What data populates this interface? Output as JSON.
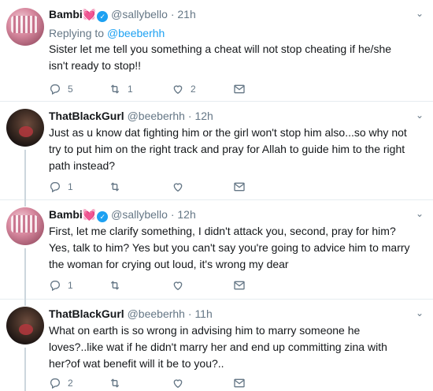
{
  "tweets": [
    {
      "name": "Bambi",
      "emoji": "💓",
      "handle": "@sallybello",
      "time": "21h",
      "reply_prefix": "Replying to",
      "reply_handle": "@beeberhh",
      "text": "Sister let me tell you something a cheat will not stop cheating if he/she isn't ready to stop!!",
      "replies": "5",
      "retweets": "1",
      "likes": "2",
      "avatar_icon": "pink-avatar"
    },
    {
      "name": "ThatBlackGurl",
      "handle": "@beeberhh",
      "time": "12h",
      "text": "Just as u know dat fighting him or the girl won't stop him also...so why not try to put him on the right track and pray for Allah to guide him to the right path instead?",
      "replies": "1",
      "retweets": "",
      "likes": "",
      "avatar_icon": "dark-avatar"
    },
    {
      "name": "Bambi",
      "emoji": "💓",
      "handle": "@sallybello",
      "time": "12h",
      "text": "First, let me clarify something, I didn't attack you, second, pray for him? Yes, talk to him? Yes but you can't say you're going to advice him to marry the woman for crying out loud, it's wrong my dear",
      "replies": "1",
      "retweets": "",
      "likes": "",
      "avatar_icon": "pink-avatar"
    },
    {
      "name": "ThatBlackGurl",
      "handle": "@beeberhh",
      "time": "11h",
      "text": "What on earth is so wrong in advising him to marry someone he loves?..like wat if he didn't marry her and  end up committing zina with her?of wat benefit will it be to you?..",
      "replies": "2",
      "retweets": "",
      "likes": "",
      "avatar_icon": "dark-avatar"
    }
  ],
  "dot": "·",
  "colors": {
    "accent": "#1da1f2",
    "muted": "#657786",
    "text": "#14171a",
    "divider": "#e6ecf0"
  }
}
